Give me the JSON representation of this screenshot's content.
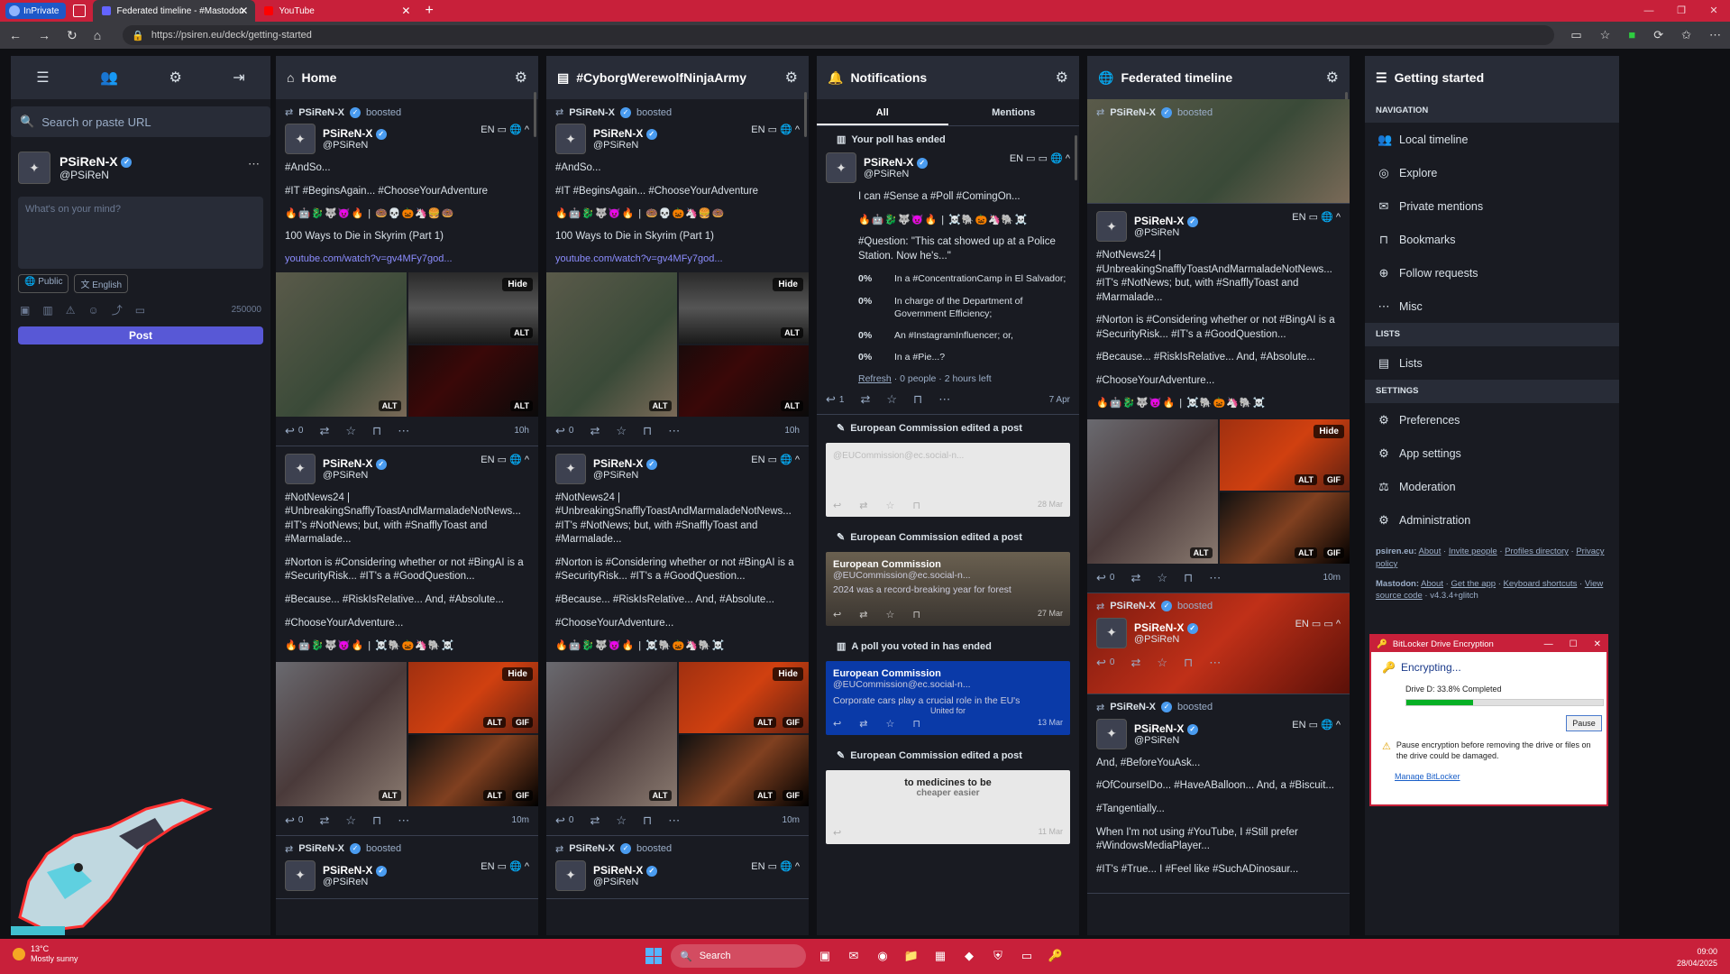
{
  "browser": {
    "inprivate_label": "InPrivate",
    "tabs": [
      {
        "title": "Federated timeline - #Mastodon",
        "active": true
      },
      {
        "title": "YouTube",
        "active": false
      }
    ],
    "url": "https://psiren.eu/deck/getting-started"
  },
  "compose": {
    "search_placeholder": "Search or paste URL",
    "profile_name": "PSiReN-X",
    "profile_acct": "@PSiReN",
    "composer_placeholder": "What's on your mind?",
    "visibility": "Public",
    "language": "English",
    "char_count": "250000",
    "post_label": "Post"
  },
  "columns": {
    "home": {
      "title": "Home"
    },
    "hashtag": {
      "title": "#CyborgWerewolfNinjaArmy"
    },
    "notifications": {
      "title": "Notifications",
      "tab_all": "All",
      "tab_mentions": "Mentions"
    },
    "federated": {
      "title": "Federated timeline"
    }
  },
  "posts": {
    "boosted_label": "boosted",
    "author": "PSiReN-X",
    "acct": "@PSiReN",
    "lang": "EN",
    "skyrim": {
      "line1": "#AndSo...",
      "line2": "#IT #BeginsAgain... #ChooseYourAdventure",
      "emoji": "🔥🤖🐉🐺😈🔥 | 🍩💀🎃🦄🍔🍩",
      "line3": "100 Ways to Die in Skyrim (Part 1)",
      "link": "youtube.com/watch?v=gv4MFy7god...",
      "hide": "Hide",
      "alt": "ALT",
      "replies": "0",
      "time": "10h"
    },
    "news": {
      "line1": "#NotNews24 | #UnbreakingSnafflyToastAndMarmaladeNotNews... #IT's #NotNews; but, with #SnafflyToast and #Marmalade...",
      "line2": "#Norton is #Considering whether or not #BingAI is a #SecurityRisk... #IT's a #GoodQuestion...",
      "line3": "#Because... #RiskIsRelative... And, #Absolute...",
      "line4": "#ChooseYourAdventure...",
      "emoji": "🔥🤖🐉🐺😈🔥 | ☠️🐘🎃🦄🐘☠️",
      "hide": "Hide",
      "alt": "ALT",
      "gif": "GIF",
      "replies": "0",
      "time": "10m"
    },
    "balloon": {
      "line1": "And, #BeforeYouAsk...",
      "line2": "#OfCourseIDo... #HaveABalloon... And, a #Biscuit...",
      "line3": "#Tangentially...",
      "line4": "When I'm not using #YouTube, I #Still prefer #WindowsMediaPlayer...",
      "line5": "#IT's #True... I #Feel like #SuchADinosaur..."
    },
    "fed_time": "10m"
  },
  "notifications": {
    "poll_ended": "Your poll has ended",
    "poll_text1": "I can #Sense a #Poll #ComingOn...",
    "poll_emoji": "🔥🤖🐉🐺😈🔥 | ☠️🐘🎃🦄🐘☠️",
    "poll_question": "#Question: \"This cat showed up at a Police Station. Now he's...\"",
    "options": [
      {
        "pct": "0%",
        "text": "In a #ConcentrationCamp in El Salvador;"
      },
      {
        "pct": "0%",
        "text": "In charge of the Department of Government Efficiency;"
      },
      {
        "pct": "0%",
        "text": "An #InstagramInfluencer; or,"
      },
      {
        "pct": "0%",
        "text": "In a #Pie...?"
      }
    ],
    "refresh": "Refresh",
    "poll_meta": "· 0 people · 2 hours left",
    "poll_replies": "1",
    "poll_date": "7 Apr",
    "ec_edited": "European Commission edited a post",
    "ec_name": "European Commission",
    "ec_acct": "@EUCommission@ec.social-n...",
    "ec_text2": "2024 was a record-breaking year for forest",
    "ec_text3": "Corporate cars play a crucial role in the EU's",
    "ec_date1": "28 Mar",
    "ec_date2": "27 Mar",
    "ec_date3": "13 Mar",
    "ec_date4": "11 Mar",
    "voted_ended": "A poll you voted in has ended",
    "medicine_text": "to medicines to be",
    "medicine_text2": "cheaper easier",
    "c3_overlay": "United for"
  },
  "getting_started": {
    "title": "Getting started",
    "nav_label": "Navigation",
    "nav": [
      "Local timeline",
      "Explore",
      "Private mentions",
      "Bookmarks",
      "Follow requests",
      "Misc"
    ],
    "lists_label": "Lists",
    "lists": [
      "Lists"
    ],
    "settings_label": "Settings",
    "settings": [
      "Preferences",
      "App settings",
      "Moderation",
      "Administration"
    ],
    "footer1_prefix": "psiren.eu:",
    "footer1_links": [
      "About",
      "Invite people",
      "Profiles directory",
      "Privacy policy"
    ],
    "footer2_prefix": "Mastodon:",
    "footer2_links": [
      "About",
      "Get the app",
      "Keyboard shortcuts",
      "View source code"
    ],
    "version": "v4.3.4+glitch"
  },
  "bitlocker": {
    "title": "BitLocker Drive Encryption",
    "status": "Encrypting...",
    "drive": "Drive D: 33.8% Completed",
    "progress": 0.338,
    "pause": "Pause",
    "warning": "Pause encryption before removing the drive or files on the drive could be damaged.",
    "manage": "Manage BitLocker"
  },
  "taskbar": {
    "temp": "13°C",
    "weather": "Mostly sunny",
    "search": "Search",
    "time": "09:00",
    "date": "28/04/2025"
  }
}
